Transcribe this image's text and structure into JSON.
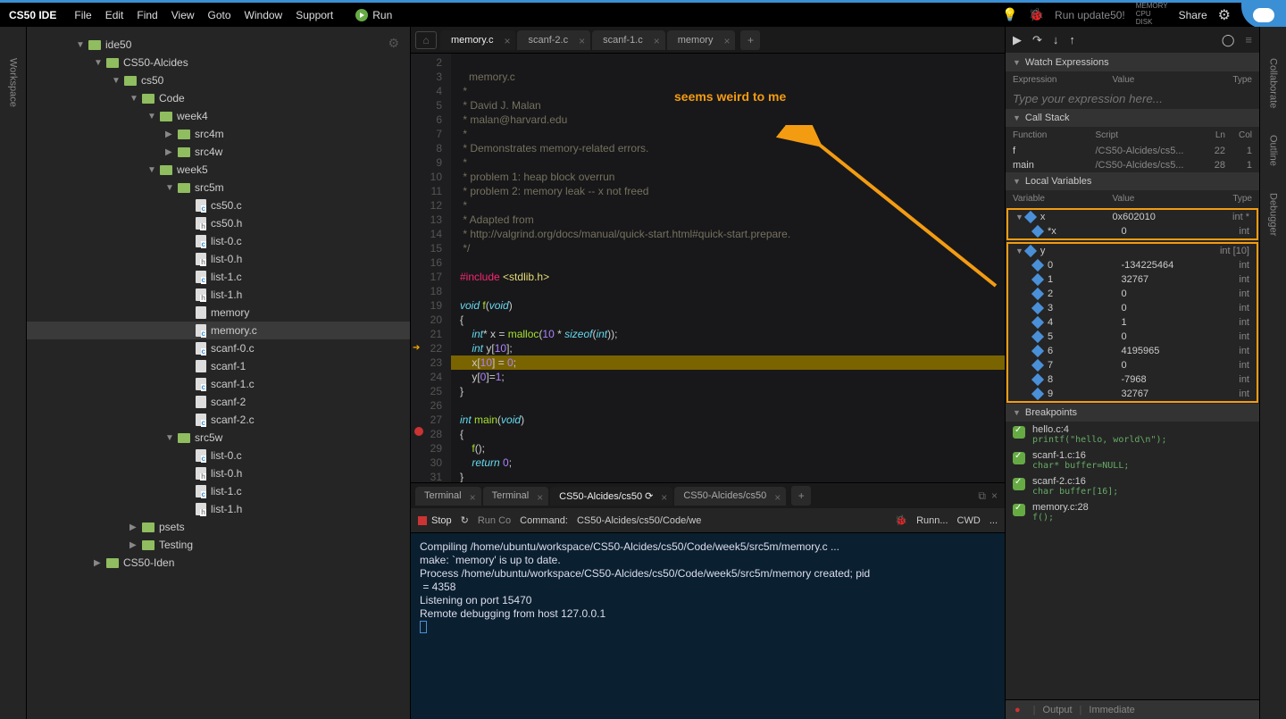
{
  "brand": "CS50 IDE",
  "menu": [
    "File",
    "Edit",
    "Find",
    "View",
    "Goto",
    "Window",
    "Support"
  ],
  "run_label": "Run",
  "update_text": "Run update50!",
  "share_label": "Share",
  "resources": [
    "MEMORY",
    "CPU",
    "DISK"
  ],
  "left_tabs": [
    "Workspace"
  ],
  "right_tabs": [
    "Collaborate",
    "Outline",
    "Debugger"
  ],
  "tree": [
    {
      "depth": 1,
      "type": "folder",
      "arrow": "down",
      "name": "ide50"
    },
    {
      "depth": 2,
      "type": "folder",
      "arrow": "down",
      "name": "CS50-Alcides"
    },
    {
      "depth": 3,
      "type": "folder",
      "arrow": "down",
      "name": "cs50"
    },
    {
      "depth": 4,
      "type": "folder",
      "arrow": "down",
      "name": "Code"
    },
    {
      "depth": 5,
      "type": "folder",
      "arrow": "down",
      "name": "week4"
    },
    {
      "depth": 6,
      "type": "folder",
      "arrow": "right",
      "name": "src4m"
    },
    {
      "depth": 6,
      "type": "folder",
      "arrow": "right",
      "name": "src4w"
    },
    {
      "depth": 5,
      "type": "folder",
      "arrow": "down",
      "name": "week5"
    },
    {
      "depth": 6,
      "type": "folder",
      "arrow": "down",
      "name": "src5m"
    },
    {
      "depth": 6,
      "type": "file",
      "ext": "c",
      "name": "cs50.c",
      "pad": 1
    },
    {
      "depth": 6,
      "type": "file",
      "ext": "h",
      "name": "cs50.h",
      "pad": 1
    },
    {
      "depth": 6,
      "type": "file",
      "ext": "c",
      "name": "list-0.c",
      "pad": 1
    },
    {
      "depth": 6,
      "type": "file",
      "ext": "h",
      "name": "list-0.h",
      "pad": 1
    },
    {
      "depth": 6,
      "type": "file",
      "ext": "c",
      "name": "list-1.c",
      "pad": 1
    },
    {
      "depth": 6,
      "type": "file",
      "ext": "h",
      "name": "list-1.h",
      "pad": 1
    },
    {
      "depth": 6,
      "type": "file",
      "ext": "",
      "name": "memory",
      "pad": 1
    },
    {
      "depth": 6,
      "type": "file",
      "ext": "c",
      "name": "memory.c",
      "pad": 1,
      "active": true
    },
    {
      "depth": 6,
      "type": "file",
      "ext": "c",
      "name": "scanf-0.c",
      "pad": 1
    },
    {
      "depth": 6,
      "type": "file",
      "ext": "",
      "name": "scanf-1",
      "pad": 1
    },
    {
      "depth": 6,
      "type": "file",
      "ext": "c",
      "name": "scanf-1.c",
      "pad": 1
    },
    {
      "depth": 6,
      "type": "file",
      "ext": "",
      "name": "scanf-2",
      "pad": 1
    },
    {
      "depth": 6,
      "type": "file",
      "ext": "c",
      "name": "scanf-2.c",
      "pad": 1
    },
    {
      "depth": 6,
      "type": "folder",
      "arrow": "down",
      "name": "src5w"
    },
    {
      "depth": 6,
      "type": "file",
      "ext": "c",
      "name": "list-0.c",
      "pad": 1
    },
    {
      "depth": 6,
      "type": "file",
      "ext": "h",
      "name": "list-0.h",
      "pad": 1
    },
    {
      "depth": 6,
      "type": "file",
      "ext": "c",
      "name": "list-1.c",
      "pad": 1
    },
    {
      "depth": 6,
      "type": "file",
      "ext": "h",
      "name": "list-1.h",
      "pad": 1
    },
    {
      "depth": 4,
      "type": "folder",
      "arrow": "right",
      "name": "psets"
    },
    {
      "depth": 4,
      "type": "folder",
      "arrow": "right",
      "name": "Testing"
    },
    {
      "depth": 2,
      "type": "folder",
      "arrow": "right",
      "name": "CS50-Iden"
    }
  ],
  "editor_tabs": [
    {
      "label": "memory.c",
      "active": true
    },
    {
      "label": "scanf-2.c"
    },
    {
      "label": "scanf-1.c"
    },
    {
      "label": "memory"
    }
  ],
  "gutter": [
    "2",
    "3",
    "4",
    "5",
    "6",
    "7",
    "8",
    "9",
    "10",
    "11",
    "12",
    "13",
    "14",
    "15",
    "16",
    "17",
    "18",
    "19",
    "20",
    "21",
    "22",
    "23",
    "24",
    "25",
    "26",
    "27",
    "28",
    "29",
    "30",
    "31"
  ],
  "breakpoint_line_index": 26,
  "current_line_index": 20,
  "annotation_text": "seems weird to me",
  "terminal_tabs": [
    {
      "label": "Terminal"
    },
    {
      "label": "Terminal"
    },
    {
      "label": "CS50-Alcides/cs50",
      "active": true,
      "spinner": true
    },
    {
      "label": "CS50-Alcides/cs50"
    }
  ],
  "term_toolbar": {
    "stop": "Stop",
    "runcfg": "Run Co",
    "command_label": "Command:",
    "command_value": "CS50-Alcides/cs50/Code/we",
    "runner_label": "Runn...",
    "cwd_label": "CWD",
    "dots": "..."
  },
  "terminal_output": "Compiling /home/ubuntu/workspace/CS50-Alcides/cs50/Code/week5/src5m/memory.c ...\nmake: `memory' is up to date.\nProcess /home/ubuntu/workspace/CS50-Alcides/cs50/Code/week5/src5m/memory created; pid\n = 4358\nListening on port 15470\nRemote debugging from host 127.0.0.1",
  "debugger": {
    "watch": {
      "title": "Watch Expressions",
      "cols": [
        "Expression",
        "Value",
        "Type"
      ],
      "placeholder": "Type your expression here..."
    },
    "callstack": {
      "title": "Call Stack",
      "cols": [
        "Function",
        "Script",
        "Ln",
        "Col"
      ],
      "rows": [
        {
          "fn": "f",
          "script": "/CS50-Alcides/cs5...",
          "ln": "22",
          "col": "1"
        },
        {
          "fn": "main",
          "script": "/CS50-Alcides/cs5...",
          "ln": "28",
          "col": "1"
        }
      ]
    },
    "vars": {
      "title": "Local Variables",
      "cols": [
        "Variable",
        "Value",
        "Type"
      ],
      "x": {
        "name": "x",
        "val": "0x602010",
        "type": "int *",
        "deref": {
          "name": "*x",
          "val": "0",
          "type": "int"
        }
      },
      "y": {
        "name": "y",
        "type": "int [10]",
        "items": [
          {
            "i": "0",
            "v": "-134225464",
            "t": "int"
          },
          {
            "i": "1",
            "v": "32767",
            "t": "int"
          },
          {
            "i": "2",
            "v": "0",
            "t": "int"
          },
          {
            "i": "3",
            "v": "0",
            "t": "int"
          },
          {
            "i": "4",
            "v": "1",
            "t": "int"
          },
          {
            "i": "5",
            "v": "0",
            "t": "int"
          },
          {
            "i": "6",
            "v": "4195965",
            "t": "int"
          },
          {
            "i": "7",
            "v": "0",
            "t": "int"
          },
          {
            "i": "8",
            "v": "-7968",
            "t": "int"
          },
          {
            "i": "9",
            "v": "32767",
            "t": "int"
          }
        ]
      }
    },
    "breakpoints": {
      "title": "Breakpoints",
      "items": [
        {
          "loc": "hello.c:4",
          "code": "printf(\"hello, world\\n\");"
        },
        {
          "loc": "scanf-1.c:16",
          "code": "char* buffer=NULL;"
        },
        {
          "loc": "scanf-2.c:16",
          "code": "char buffer[16];"
        },
        {
          "loc": "memory.c:28",
          "code": "f();"
        }
      ]
    }
  },
  "statusbar": {
    "output": "Output",
    "immediate": "Immediate"
  }
}
